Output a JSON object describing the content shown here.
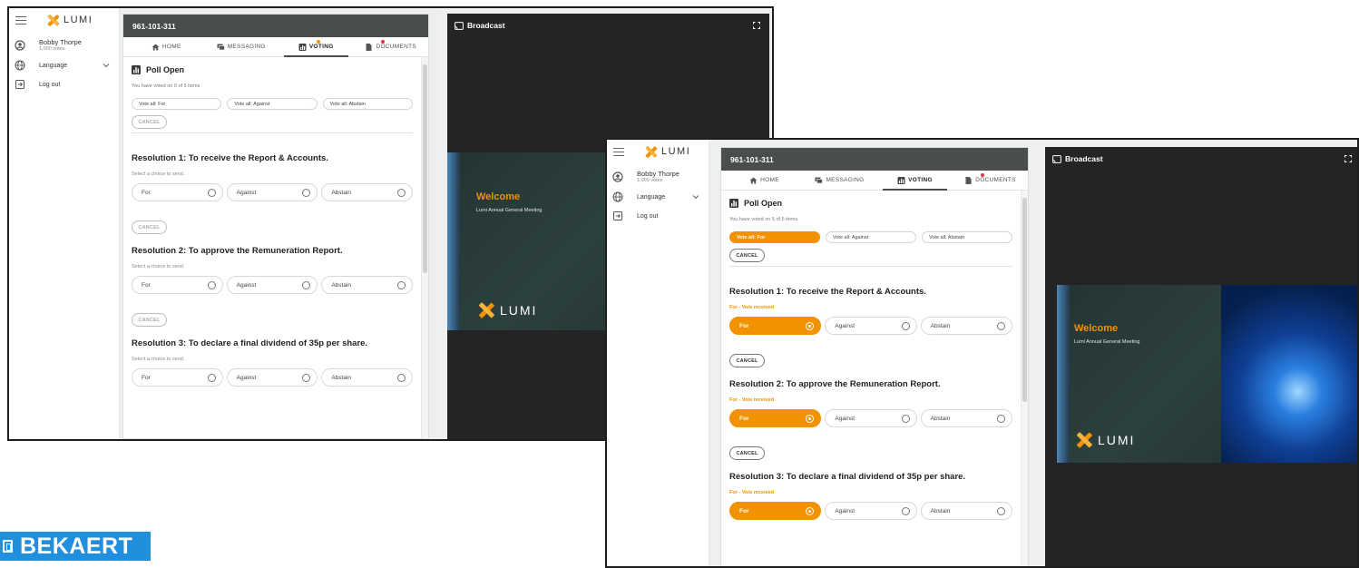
{
  "brand": {
    "logo_text": "LUMI",
    "accent": "#f29200",
    "bekaert_text": "BEKAERT",
    "bekaert_color": "#1f8fde"
  },
  "sidebar": {
    "user_name": "Bobby Thorpe",
    "user_votes": "1,000 votes",
    "language_label": "Language",
    "logout_label": "Log out"
  },
  "panel": {
    "meeting_id": "961-101-311",
    "tabs": [
      {
        "label": "HOME",
        "icon": "home-icon"
      },
      {
        "label": "MESSAGING",
        "icon": "messaging-icon"
      },
      {
        "label": "VOTING",
        "icon": "voting-icon"
      },
      {
        "label": "DOCUMENTS",
        "icon": "documents-icon"
      }
    ],
    "poll_title": "Poll Open",
    "vote_all": [
      "Vote all: For",
      "Vote all: Against",
      "Vote all: Abstain"
    ],
    "cancel_label": "CANCEL",
    "choices": [
      "For",
      "Against",
      "Abstain"
    ],
    "resolutions": [
      "Resolution 1: To receive the Report & Accounts.",
      "Resolution 2: To approve the Remuneration Report.",
      "Resolution 3: To declare a final dividend of 35p per share."
    ]
  },
  "before": {
    "voted_text": "You have voted on 0 of 5 items",
    "hint": "Select a choice to send."
  },
  "after": {
    "voted_text": "You have voted on 5 of 5 items",
    "hint": "For - Vote received",
    "selected_vote_all": "Vote all: For",
    "selected_choice": "For"
  },
  "broadcast": {
    "title": "Broadcast",
    "welcome": "Welcome",
    "subtitle": "Lumi Annual General Meeting"
  }
}
